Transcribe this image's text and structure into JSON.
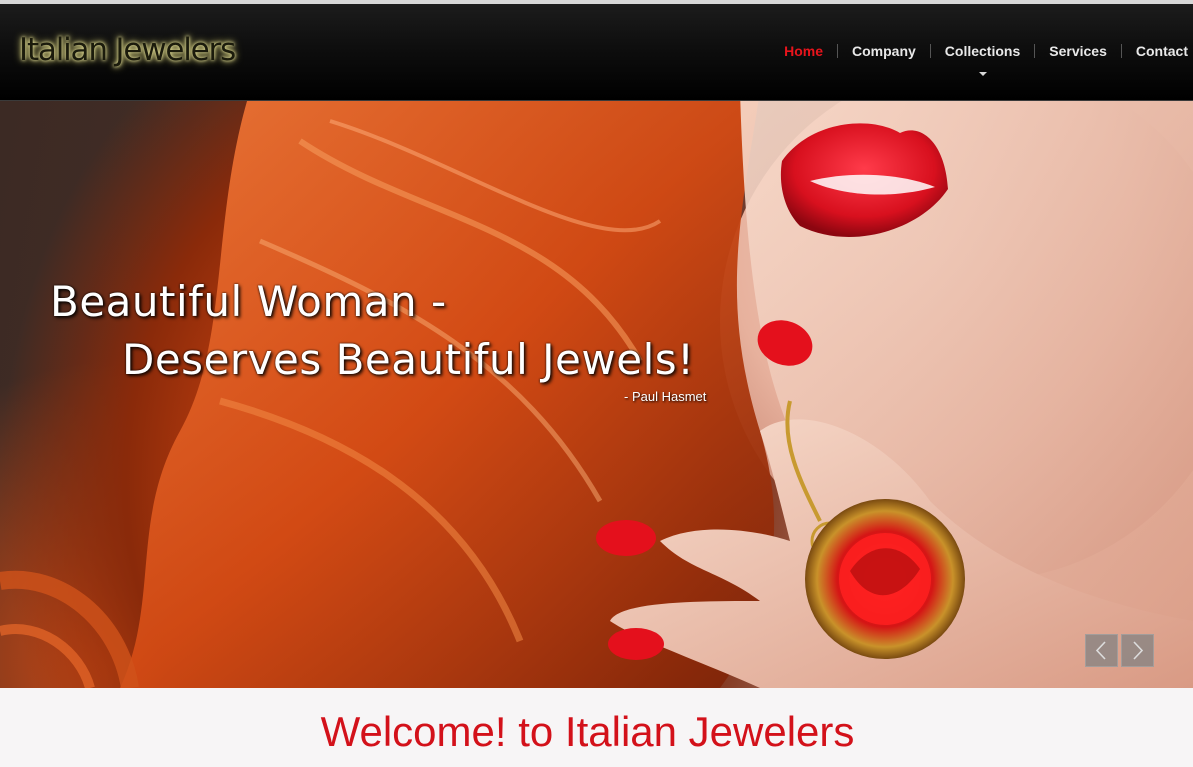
{
  "header": {
    "logo_text": "Italian Jewelers"
  },
  "nav": {
    "items": [
      {
        "label": "Home",
        "active": true
      },
      {
        "label": "Company",
        "active": false
      },
      {
        "label": "Collections",
        "active": false,
        "has_dropdown": true
      },
      {
        "label": "Services",
        "active": false
      },
      {
        "label": "Contact",
        "active": false
      }
    ]
  },
  "hero": {
    "quote_line1": "Beautiful Woman -",
    "quote_line2": "Deserves Beautiful Jewels!",
    "quote_author": "- Paul Hasmet",
    "prev_icon": "chevron-left-icon",
    "next_icon": "chevron-right-icon"
  },
  "welcome": {
    "title": "Welcome! to Italian Jewelers"
  },
  "colors": {
    "header_bg": "#0e0e0e",
    "nav_active": "#e8141c",
    "nav_text": "#e8e8e8",
    "welcome_title": "#d3111a",
    "page_bg": "#f7f5f6"
  }
}
